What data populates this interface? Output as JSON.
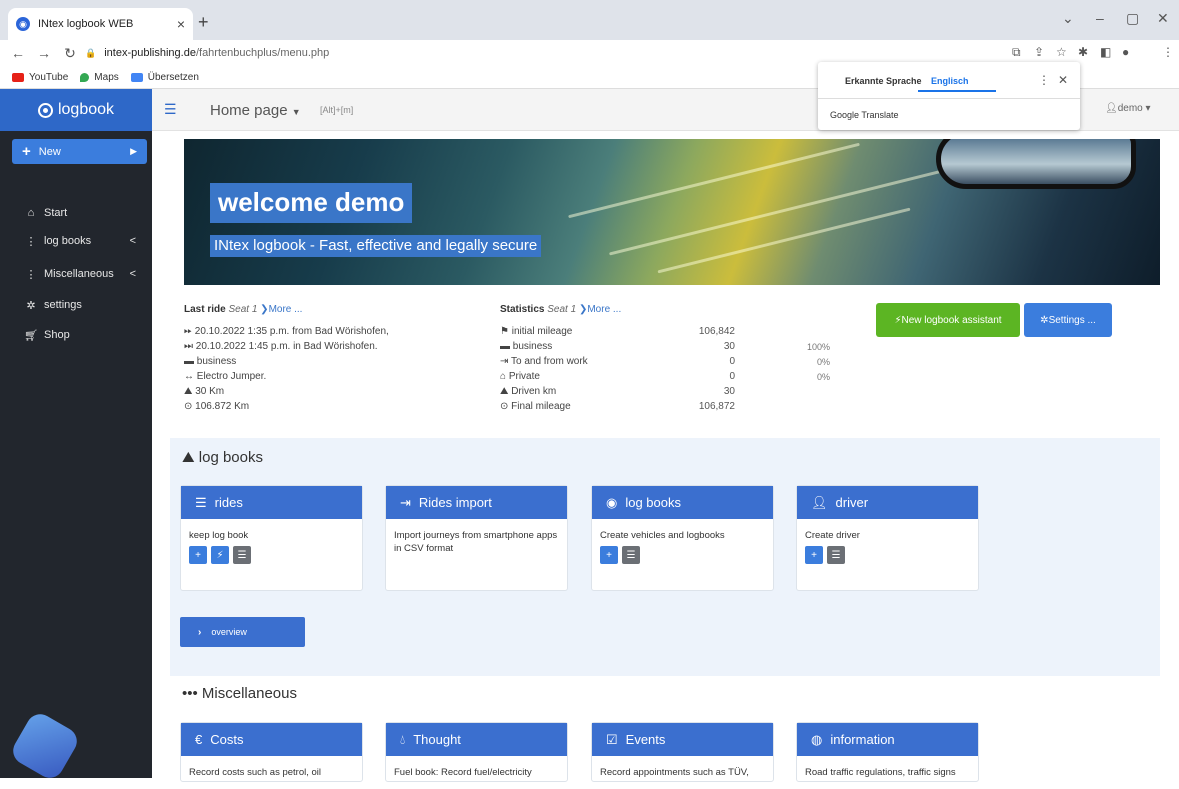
{
  "browser": {
    "tab_title": "INtex logbook WEB",
    "tab_close": "×",
    "new_tab": "+",
    "url_host": "intex-publishing.de",
    "url_path": "/fahrtenbuchplus/menu.php",
    "bookmarks": [
      "YouTube",
      "Maps",
      "Übersetzen"
    ]
  },
  "translate_popup": {
    "detected_label": "Erkannte Sprache",
    "selected_language": "Englisch",
    "footer": "Google Translate"
  },
  "sidebar": {
    "brand": "logbook",
    "new_button": "New",
    "items": [
      {
        "label": "Start",
        "icon": "home-icon"
      },
      {
        "label": "log books",
        "icon": "dots-vertical-icon",
        "chevron": "<"
      },
      {
        "label": "Miscellaneous",
        "icon": "dots-vertical-icon",
        "chevron": "<"
      },
      {
        "label": "settings",
        "icon": "gear-icon"
      },
      {
        "label": "Shop",
        "icon": "cart-icon"
      }
    ]
  },
  "topbar": {
    "title": "Home page",
    "shortcut": "[Alt]+[m]",
    "user": "demo"
  },
  "banner": {
    "welcome": "welcome demo",
    "tagline": "INtex logbook - Fast, effective and legally secure"
  },
  "last_ride": {
    "title": "Last ride",
    "seat": "Seat 1",
    "more": "More ...",
    "lines": [
      "20.10.2022 1:35 p.m. from Bad Wörishofen,",
      "20.10.2022 1:45 p.m. in Bad Wörishofen.",
      "business",
      "Electro Jumper.",
      "30 Km",
      "106.872 Km"
    ]
  },
  "statistics": {
    "title": "Statistics",
    "seat": "Seat 1",
    "more": "More ...",
    "rows": [
      {
        "label": "initial mileage",
        "value": "106,842",
        "pct": ""
      },
      {
        "label": "business",
        "value": "30",
        "pct": "100%"
      },
      {
        "label": "To and from work",
        "value": "0",
        "pct": "0%"
      },
      {
        "label": "Private",
        "value": "0",
        "pct": "0%"
      },
      {
        "label": "Driven km",
        "value": "30",
        "pct": ""
      },
      {
        "label": "Final mileage",
        "value": "106,872",
        "pct": ""
      }
    ]
  },
  "actions": {
    "assistant": "New logbook assistant",
    "settings": "Settings ..."
  },
  "logbooks_section": {
    "title": "log books",
    "cards": [
      {
        "title": "rides",
        "text": "keep log book"
      },
      {
        "title": "Rides import",
        "text": "Import journeys from smartphone apps in CSV format"
      },
      {
        "title": "log books",
        "text": "Create vehicles and logbooks"
      },
      {
        "title": "driver",
        "text": "Create driver"
      }
    ],
    "overview_button": "overview"
  },
  "misc_section": {
    "title": "Miscellaneous",
    "cards": [
      {
        "title": "Costs",
        "text": "Record costs such as petrol, oil"
      },
      {
        "title": "Thought",
        "text": "Fuel book: Record fuel/electricity"
      },
      {
        "title": "Events",
        "text": "Record appointments such as TÜV,"
      },
      {
        "title": "information",
        "text": "Road traffic regulations, traffic signs"
      }
    ]
  },
  "colors": {
    "brand_blue": "#2e68c8",
    "card_header": "#3b6fcf",
    "assistant_green": "#5cb523",
    "sidebar_bg": "#22262d"
  }
}
